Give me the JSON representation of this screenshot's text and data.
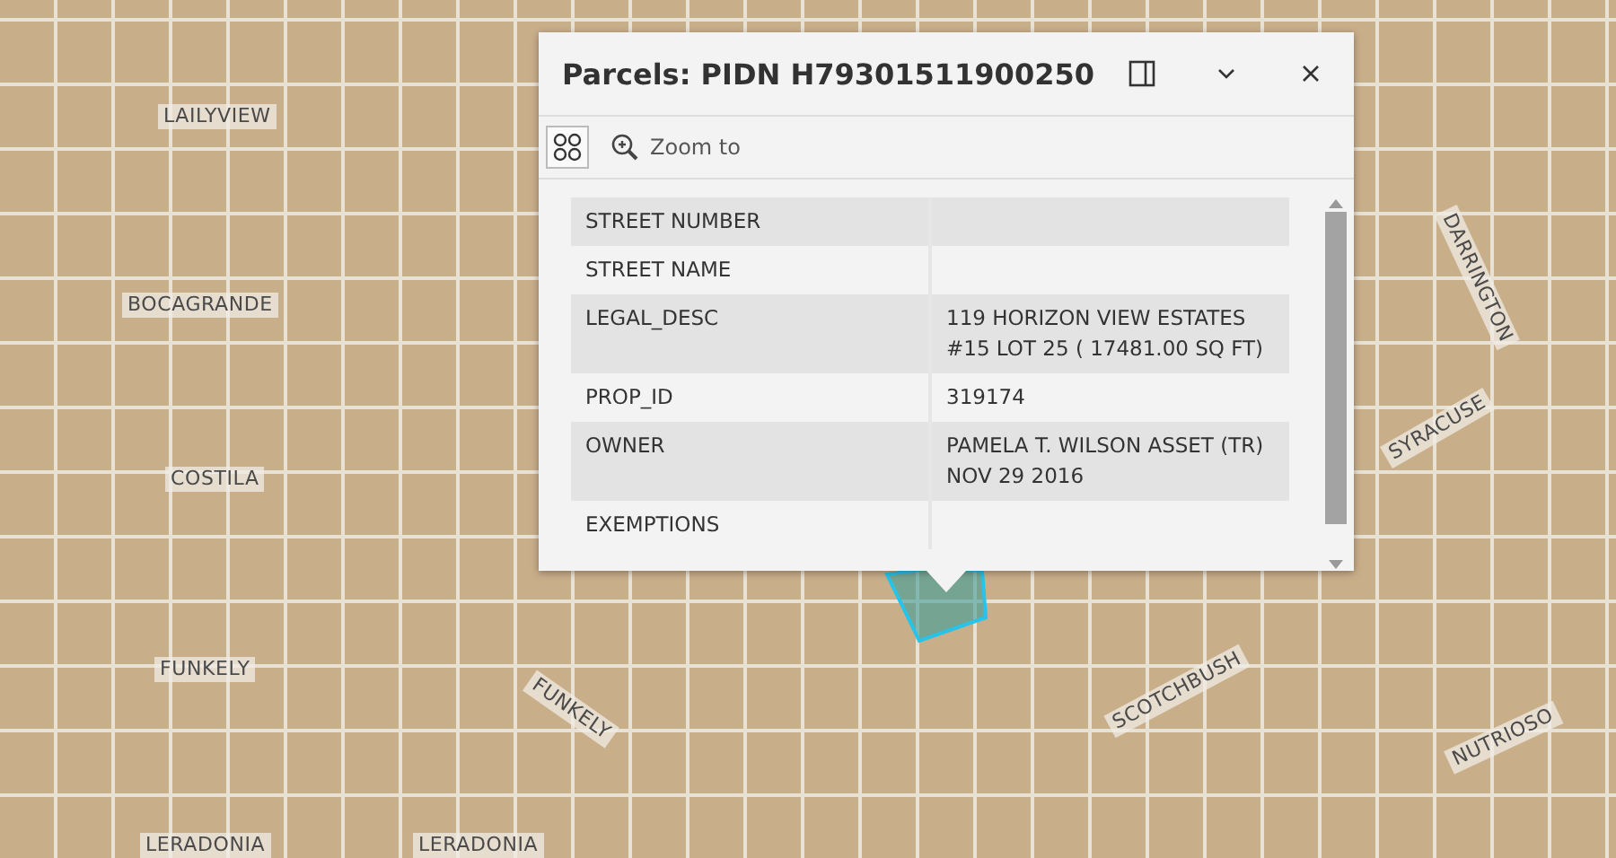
{
  "map": {
    "street_labels": [
      {
        "text": "LAILYVIEW"
      },
      {
        "text": "BOCAGRANDE"
      },
      {
        "text": "COSTILA"
      },
      {
        "text": "FUNKELY"
      },
      {
        "text": "FUNKELY"
      },
      {
        "text": "LERADONIA"
      },
      {
        "text": "LERADONIA"
      },
      {
        "text": "DARRINGTON"
      },
      {
        "text": "SYRACUSE"
      },
      {
        "text": "SCOTCHBUSH"
      },
      {
        "text": "NUTRIOSO"
      }
    ]
  },
  "popup": {
    "title": "Parcels: PIDN H79301511900250",
    "toolbar": {
      "zoom_label": "Zoom to"
    },
    "rows": [
      {
        "field": "STREET NUMBER"
      },
      {
        "field": "STREET NAME"
      },
      {
        "field": "LEGAL_DESC",
        "value_lines": [
          "119 HORIZON VIEW ESTATES",
          "#15 LOT 25 ( 17481.00 SQ FT)"
        ]
      },
      {
        "field": "PROP_ID",
        "value_lines": [
          "319174"
        ]
      },
      {
        "field": "OWNER",
        "value_lines": [
          "PAMELA T. WILSON ASSET (TR)",
          "NOV 29 2016"
        ]
      },
      {
        "field": "EXEMPTIONS"
      }
    ]
  }
}
